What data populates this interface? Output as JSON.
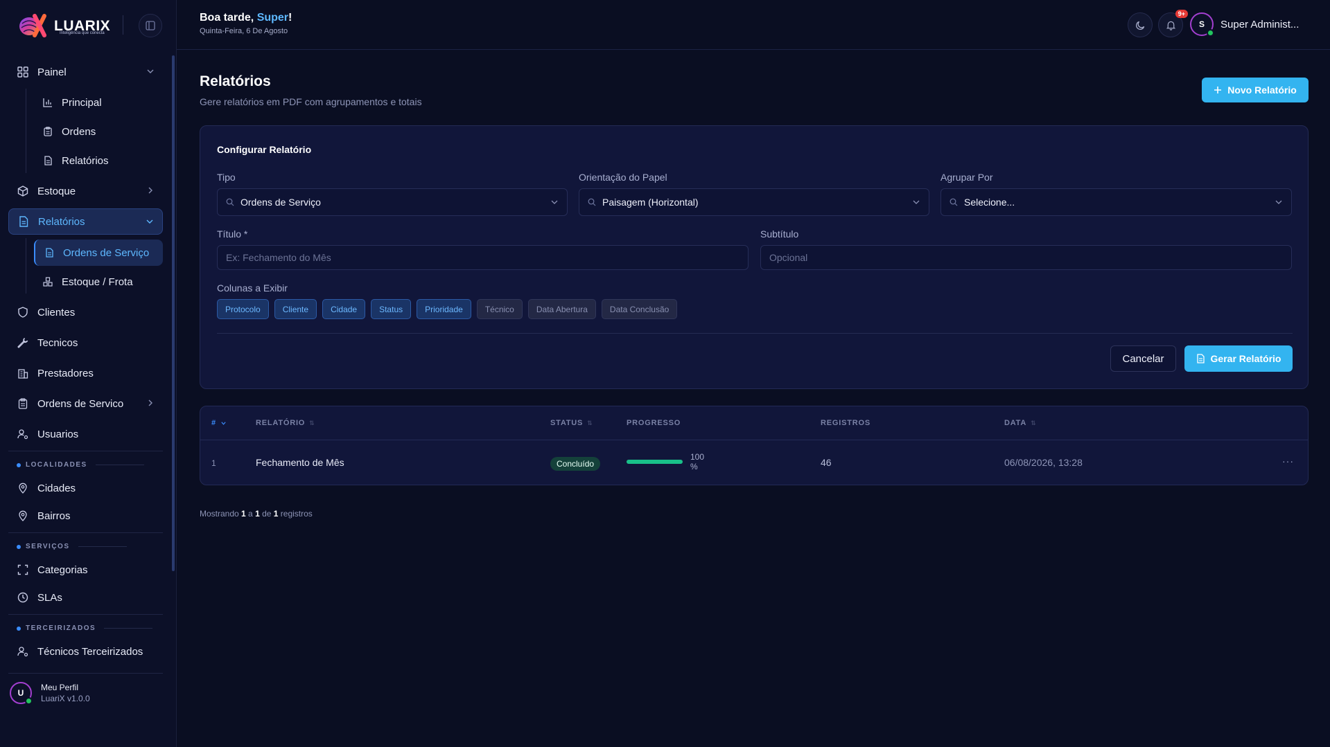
{
  "brand": {
    "name": "LUARIX",
    "tagline": "Inteligência que conecta"
  },
  "sidebar": {
    "painel": {
      "label": "Painel"
    },
    "painel_sub": [
      {
        "label": "Principal",
        "icon": "bar-chart-icon"
      },
      {
        "label": "Ordens",
        "icon": "clipboard-icon"
      },
      {
        "label": "Relatórios",
        "icon": "file-icon"
      }
    ],
    "estoque": {
      "label": "Estoque"
    },
    "relatorios": {
      "label": "Relatórios"
    },
    "relatorios_sub": [
      {
        "label": "Ordens de Serviço",
        "icon": "file-icon"
      },
      {
        "label": "Estoque / Frota",
        "icon": "boxes-icon"
      }
    ],
    "clientes": {
      "label": "Clientes"
    },
    "tecnicos": {
      "label": "Tecnicos"
    },
    "prestadores": {
      "label": "Prestadores"
    },
    "ordens_servico": {
      "label": "Ordens de Servico"
    },
    "usuarios": {
      "label": "Usuarios"
    },
    "sections": {
      "localidades": "LOCALIDADES",
      "servicos": "SERVIÇOS",
      "terceirizados": "TERCEIRIZADOS"
    },
    "cidades": {
      "label": "Cidades"
    },
    "bairros": {
      "label": "Bairros"
    },
    "categorias": {
      "label": "Categorias"
    },
    "slas": {
      "label": "SLAs"
    },
    "tecnicos_terceirizados": {
      "label": "Técnicos Terceirizados"
    },
    "profile": {
      "initial": "U",
      "name": "Meu Perfil",
      "version": "LuariX v1.0.0"
    }
  },
  "header": {
    "greeting_prefix": "Boa tarde, ",
    "greeting_name": "Super",
    "greeting_suffix": "!",
    "date": "Quinta-Feira, 6 De Agosto",
    "notifications_badge": "9+",
    "user_initial": "S",
    "user_name": "Super Administ..."
  },
  "page": {
    "title": "Relatórios",
    "subtitle": "Gere relatórios em PDF com agrupamentos e totais",
    "new_button": "Novo Relatório"
  },
  "config": {
    "title": "Configurar Relatório",
    "tipo_label": "Tipo",
    "tipo_value": "Ordens de Serviço",
    "orientacao_label": "Orientação do Papel",
    "orientacao_value": "Paisagem (Horizontal)",
    "agrupar_label": "Agrupar Por",
    "agrupar_value": "Selecione...",
    "titulo_label": "Título *",
    "titulo_placeholder": "Ex: Fechamento do Mês",
    "subtitulo_label": "Subtítulo",
    "subtitulo_placeholder": "Opcional",
    "colunas_label": "Colunas a Exibir",
    "columns": [
      {
        "label": "Protocolo",
        "selected": true
      },
      {
        "label": "Cliente",
        "selected": true
      },
      {
        "label": "Cidade",
        "selected": true
      },
      {
        "label": "Status",
        "selected": true
      },
      {
        "label": "Prioridade",
        "selected": true
      },
      {
        "label": "Técnico",
        "selected": false
      },
      {
        "label": "Data Abertura",
        "selected": false
      },
      {
        "label": "Data Conclusão",
        "selected": false
      }
    ],
    "cancel_button": "Cancelar",
    "generate_button": "Gerar Relatório"
  },
  "table": {
    "headers": {
      "num": "#",
      "relatorio": "RELATÓRIO",
      "status": "STATUS",
      "progresso": "PROGRESSO",
      "registros": "REGISTROS",
      "data": "DATA"
    },
    "rows": [
      {
        "num": "1",
        "relatorio": "Fechamento de Mês",
        "status": "Concluído",
        "progress": 100,
        "progress_label": "100 %",
        "registros": "46",
        "data": "06/08/2026, 13:28",
        "menu": "···"
      }
    ]
  },
  "footer": {
    "prefix": "Mostrando ",
    "from": "1",
    "sep1": " a ",
    "to": "1",
    "sep2": " de ",
    "total": "1",
    "suffix": " registros"
  },
  "colors": {
    "accent": "#33b4f0",
    "active_text": "#5eb8ff",
    "success": "#19c089",
    "badge_red": "#e53935"
  }
}
